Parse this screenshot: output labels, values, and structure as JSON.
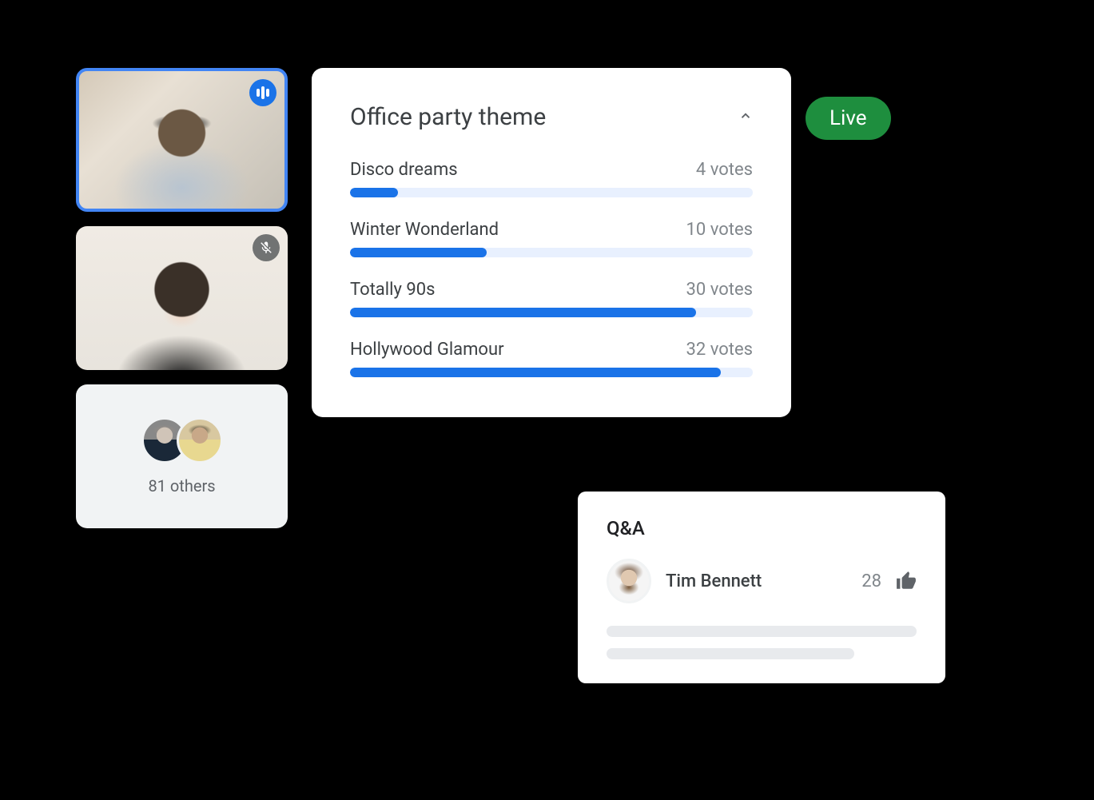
{
  "participants": {
    "others_label": "81 others"
  },
  "live_badge": "Live",
  "poll": {
    "title": "Office party theme",
    "options": [
      {
        "label": "Disco dreams",
        "votes_text": "4 votes",
        "pct": 12
      },
      {
        "label": "Winter Wonderland",
        "votes_text": "10 votes",
        "pct": 34
      },
      {
        "label": "Totally 90s",
        "votes_text": "30 votes",
        "pct": 86
      },
      {
        "label": "Hollywood Glamour",
        "votes_text": "32 votes",
        "pct": 92
      }
    ]
  },
  "qa": {
    "title": "Q&A",
    "author": "Tim Bennett",
    "upvotes": "28"
  },
  "chart_data": {
    "type": "bar",
    "title": "Office party theme",
    "categories": [
      "Disco dreams",
      "Winter Wonderland",
      "Totally 90s",
      "Hollywood Glamour"
    ],
    "values": [
      4,
      10,
      30,
      32
    ],
    "xlabel": "",
    "ylabel": "votes",
    "ylim": [
      0,
      35
    ]
  }
}
